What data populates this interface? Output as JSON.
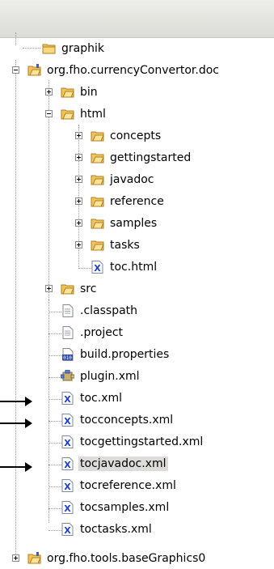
{
  "tree": {
    "items": [
      {
        "label": "graphik",
        "icon": "folder-icon"
      },
      {
        "label": "org.fho.currencyConvertor.doc",
        "icon": "project-folder-icon"
      },
      {
        "label": "bin",
        "icon": "folder-icon"
      },
      {
        "label": "html",
        "icon": "folder-icon"
      },
      {
        "label": "concepts",
        "icon": "folder-icon"
      },
      {
        "label": "gettingstarted",
        "icon": "folder-icon"
      },
      {
        "label": "javadoc",
        "icon": "folder-icon"
      },
      {
        "label": "reference",
        "icon": "folder-icon"
      },
      {
        "label": "samples",
        "icon": "folder-icon"
      },
      {
        "label": "tasks",
        "icon": "folder-icon"
      },
      {
        "label": "toc.html",
        "icon": "xml-file-icon"
      },
      {
        "label": "src",
        "icon": "folder-icon"
      },
      {
        "label": ".classpath",
        "icon": "text-file-icon"
      },
      {
        "label": ".project",
        "icon": "text-file-icon"
      },
      {
        "label": "build.properties",
        "icon": "properties-file-icon"
      },
      {
        "label": "plugin.xml",
        "icon": "plugin-icon"
      },
      {
        "label": "toc.xml",
        "icon": "xml-file-icon"
      },
      {
        "label": "tocconcepts.xml",
        "icon": "xml-file-icon"
      },
      {
        "label": "tocgettingstarted.xml",
        "icon": "xml-file-icon"
      },
      {
        "label": "tocjavadoc.xml",
        "icon": "xml-file-icon"
      },
      {
        "label": "tocreference.xml",
        "icon": "xml-file-icon"
      },
      {
        "label": "tocsamples.xml",
        "icon": "xml-file-icon"
      },
      {
        "label": "toctasks.xml",
        "icon": "xml-file-icon"
      },
      {
        "label": "org.fho.tools.baseGraphics0",
        "icon": "project-folder-icon"
      }
    ]
  },
  "colors": {
    "folder": "#f4c45c",
    "xml_blue": "#1f3fd0",
    "selection": "#dedcd8"
  }
}
